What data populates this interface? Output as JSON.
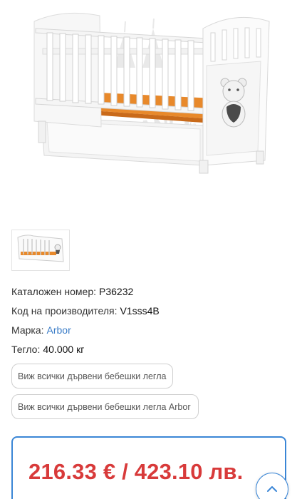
{
  "product": {
    "image_icon": "white-baby-crib-with-teddy-bear-and-orange-mattress",
    "thumbnail_icon": "crib-thumbnail",
    "watermark": "PATILANCI.BG",
    "specs": [
      {
        "label": "Каталожен номер:",
        "value": "P36232"
      },
      {
        "label": "Код на производителя:",
        "value": "V1sss4B"
      },
      {
        "label": "Марка:",
        "value": "Arbor"
      },
      {
        "label": "Тегло:",
        "value": "40.000 кг"
      }
    ],
    "links": {
      "all_wooden_cribs": "Виж всички дървени бебешки легла",
      "all_wooden_cribs_brand": "Виж всички дървени бебешки легла Arbor"
    },
    "price": "216.33 € / 423.10 лв."
  },
  "colors": {
    "price": "#d83a3a",
    "accent": "#3a86d6",
    "link": "#3a7cc7",
    "mattress": "#e8892b"
  },
  "scroll_top_icon": "chevron-up-icon"
}
